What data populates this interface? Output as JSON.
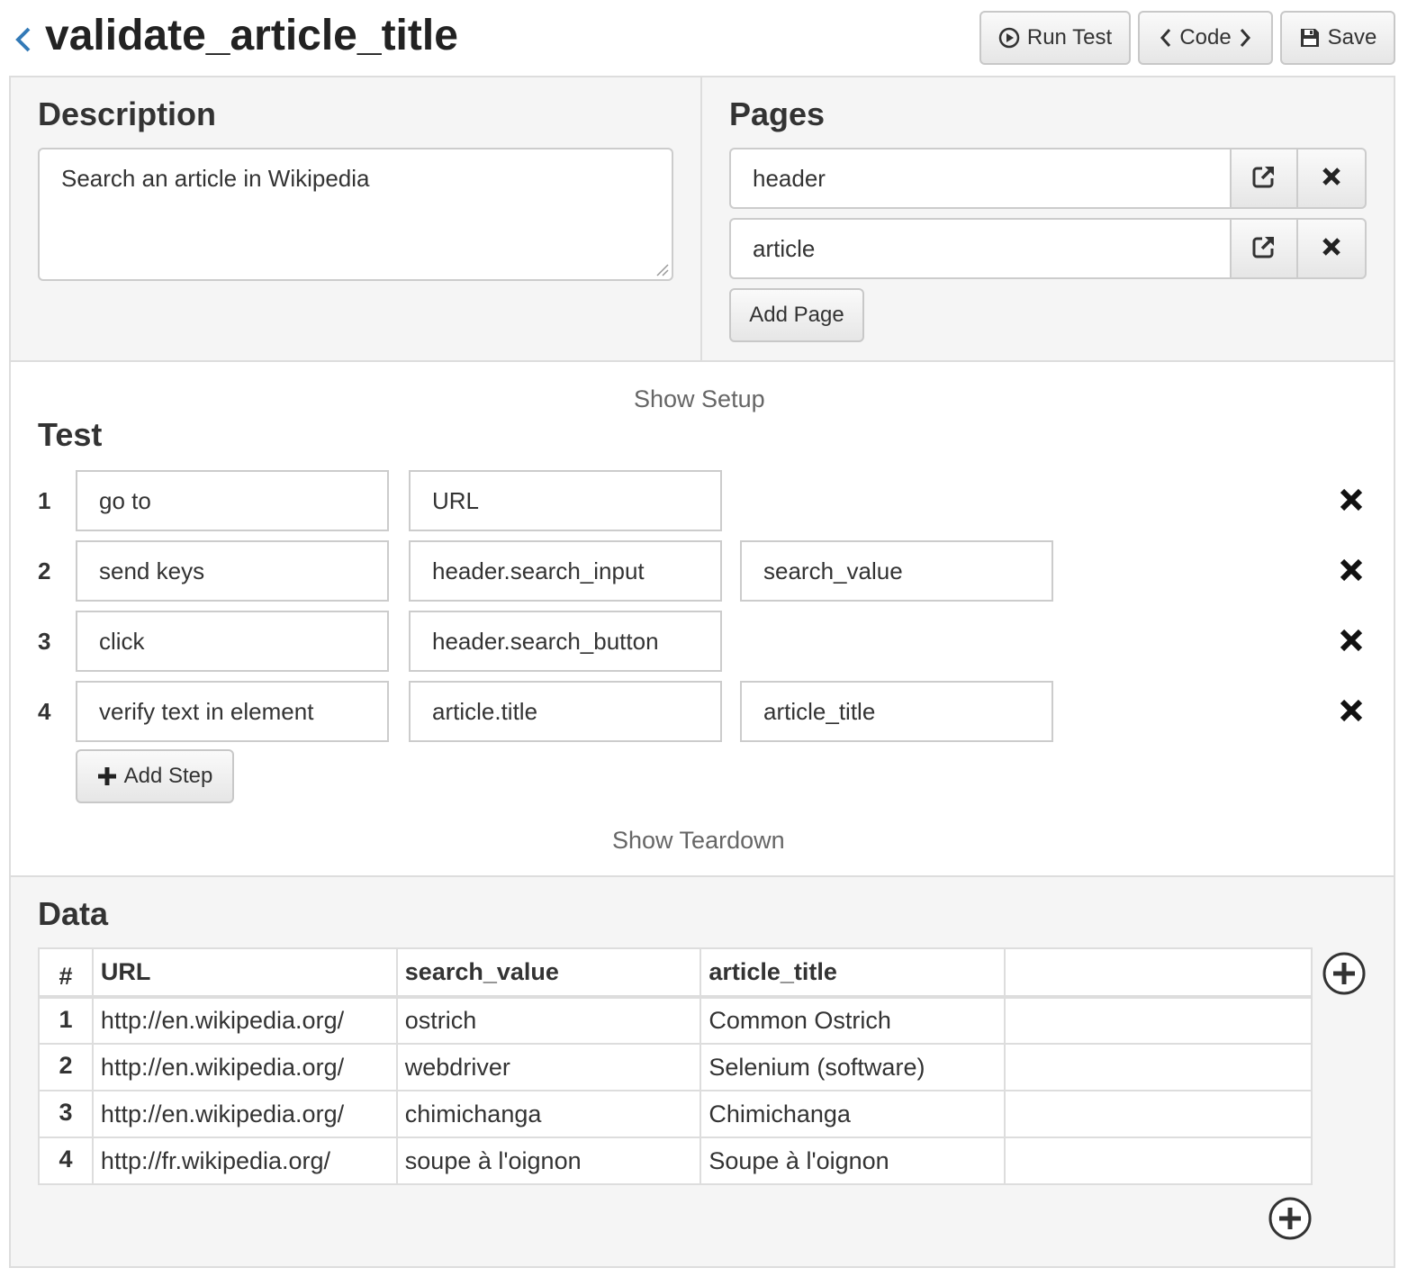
{
  "header": {
    "title": "validate_article_title",
    "buttons": {
      "run": "Run Test",
      "code": "Code",
      "save": "Save"
    }
  },
  "description": {
    "title": "Description",
    "text": "Search an article in Wikipedia"
  },
  "pages": {
    "title": "Pages",
    "items": [
      "header",
      "article"
    ],
    "add_label": "Add Page"
  },
  "test": {
    "title": "Test",
    "show_setup": "Show Setup",
    "show_teardown": "Show Teardown",
    "add_step_label": "Add Step",
    "steps": [
      {
        "num": "1",
        "action": "go to",
        "arg1": "URL",
        "arg2": ""
      },
      {
        "num": "2",
        "action": "send keys",
        "arg1": "header.search_input",
        "arg2": "search_value"
      },
      {
        "num": "3",
        "action": "click",
        "arg1": "header.search_button",
        "arg2": ""
      },
      {
        "num": "4",
        "action": "verify text in element",
        "arg1": "article.title",
        "arg2": "article_title"
      }
    ]
  },
  "data": {
    "title": "Data",
    "headers": [
      "#",
      "URL",
      "search_value",
      "article_title",
      ""
    ],
    "rows": [
      [
        "1",
        "http://en.wikipedia.org/",
        "ostrich",
        "Common Ostrich",
        ""
      ],
      [
        "2",
        "http://en.wikipedia.org/",
        "webdriver",
        "Selenium (software)",
        ""
      ],
      [
        "3",
        "http://en.wikipedia.org/",
        "chimichanga",
        "Chimichanga",
        ""
      ],
      [
        "4",
        "http://fr.wikipedia.org/",
        "soupe à l'oignon",
        "Soupe à l'oignon",
        ""
      ]
    ]
  },
  "icons": {
    "back": "chevron-left-icon",
    "run": "play-circle-icon",
    "save": "floppy-disk-icon",
    "open_page": "external-link-icon",
    "remove": "close-icon",
    "add": "plus-icon",
    "add_circle": "plus-circle-icon"
  },
  "colors": {
    "accent": "#337ab7",
    "panel_bg": "#f5f5f5",
    "border": "#dddddd"
  }
}
